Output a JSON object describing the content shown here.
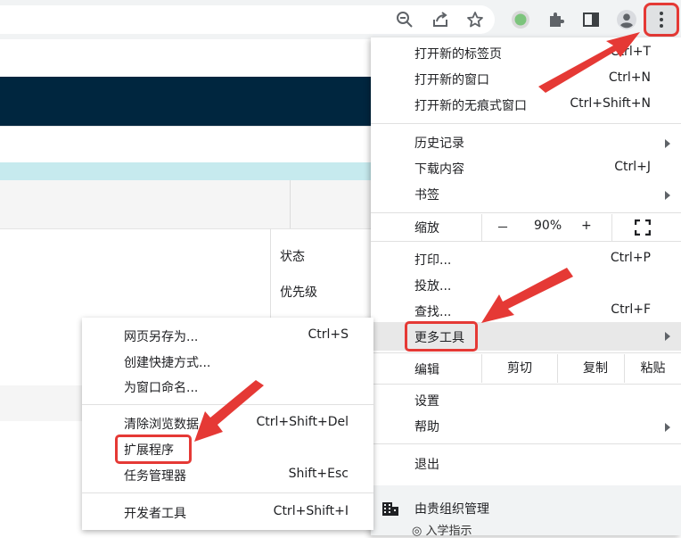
{
  "toolbar": {
    "icons": [
      "zoom-out-icon",
      "share-icon",
      "star-icon",
      "extension-status-icon",
      "puzzle-icon",
      "side-panel-icon",
      "profile-icon",
      "more-options-icon"
    ]
  },
  "page": {
    "status_label": "状态",
    "priority_label": "优先级",
    "bottom_text": "◎ 入学指示"
  },
  "menu": {
    "new_tab": {
      "label": "打开新的标签页",
      "shortcut": "Ctrl+T"
    },
    "new_window": {
      "label": "打开新的窗口",
      "shortcut": "Ctrl+N"
    },
    "new_incognito": {
      "label": "打开新的无痕式窗口",
      "shortcut": "Ctrl+Shift+N"
    },
    "history": {
      "label": "历史记录"
    },
    "downloads": {
      "label": "下载内容",
      "shortcut": "Ctrl+J"
    },
    "bookmarks": {
      "label": "书签"
    },
    "zoom": {
      "label": "缩放",
      "minus": "－",
      "value": "90%",
      "plus": "+"
    },
    "print": {
      "label": "打印...",
      "shortcut": "Ctrl+P"
    },
    "cast": {
      "label": "投放..."
    },
    "find": {
      "label": "查找...",
      "shortcut": "Ctrl+F"
    },
    "more_tools": {
      "label": "更多工具"
    },
    "edit": {
      "label": "编辑",
      "cut": "剪切",
      "copy": "复制",
      "paste": "粘贴"
    },
    "settings": {
      "label": "设置"
    },
    "help": {
      "label": "帮助"
    },
    "exit": {
      "label": "退出"
    },
    "managed": {
      "label": "由贵组织管理"
    }
  },
  "submenu": {
    "save_page": {
      "label": "网页另存为...",
      "shortcut": "Ctrl+S"
    },
    "create_shortcut": {
      "label": "创建快捷方式..."
    },
    "name_window": {
      "label": "为窗口命名..."
    },
    "clear_data": {
      "label": "清除浏览数据...",
      "shortcut": "Ctrl+Shift+Del"
    },
    "extensions": {
      "label": "扩展程序"
    },
    "task_manager": {
      "label": "任务管理器",
      "shortcut": "Shift+Esc"
    },
    "dev_tools": {
      "label": "开发者工具",
      "shortcut": "Ctrl+Shift+I"
    }
  },
  "colors": {
    "accent_red": "#e53935",
    "header_dark": "#00263f",
    "teal_strip": "#c6eaee"
  }
}
